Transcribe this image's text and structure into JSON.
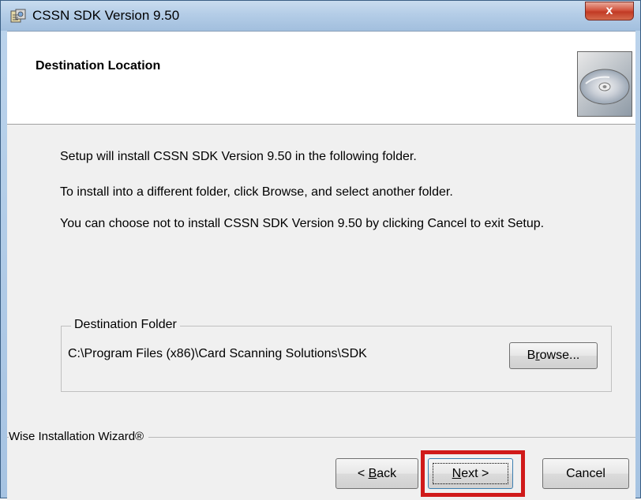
{
  "window": {
    "title": "CSSN SDK Version 9.50",
    "close_label": "x"
  },
  "header": {
    "title": "Destination Location",
    "image_icon": "cd-disc-icon"
  },
  "body": {
    "line1": "Setup will install CSSN SDK Version 9.50 in the following folder.",
    "line2": "To install into a different folder, click Browse, and select another folder.",
    "line3": "You can choose not to install CSSN SDK Version 9.50 by clicking Cancel to exit Setup."
  },
  "destination": {
    "group_label": "Destination Folder",
    "path": "C:\\Program Files (x86)\\Card Scanning Solutions\\SDK",
    "browse_pre": "B",
    "browse_accel": "r",
    "browse_post": "owse..."
  },
  "footer": {
    "brand": "Wise Installation Wizard®",
    "back_pre": "< ",
    "back_accel": "B",
    "back_post": "ack",
    "next_accel": "N",
    "next_post": "ext >",
    "cancel_label": "Cancel"
  },
  "colors": {
    "highlight": "#d01a1a",
    "titlebar": "#b4cde7",
    "dialog_bg": "#f0f0f0"
  }
}
